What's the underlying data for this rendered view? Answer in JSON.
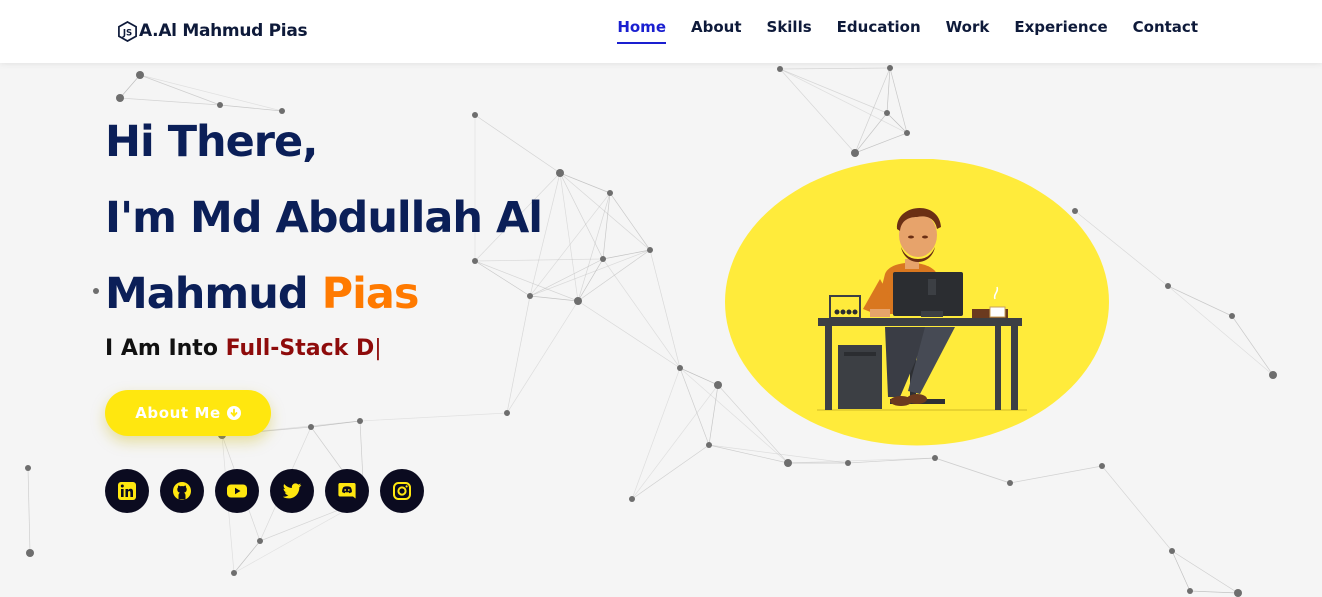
{
  "brand": {
    "text": "A.Al Mahmud Pias",
    "mark_icon": "logo-monogram-icon"
  },
  "nav": {
    "items": [
      {
        "label": "Home",
        "active": true
      },
      {
        "label": "About"
      },
      {
        "label": "Skills"
      },
      {
        "label": "Education"
      },
      {
        "label": "Work"
      },
      {
        "label": "Experience"
      },
      {
        "label": "Contact"
      }
    ]
  },
  "hero": {
    "line1": "Hi There,",
    "line2": "I'm Md Abdullah Al",
    "line3_prefix": "Mahmud ",
    "line3_accent": "Pias",
    "typed_prefix": "I Am Into ",
    "typed_text": "Full-Stack D",
    "typed_cursor": "|",
    "button_label": "About Me",
    "button_icon": "arrow-down-circle-icon"
  },
  "socials": [
    {
      "name": "linkedin-icon"
    },
    {
      "name": "github-icon"
    },
    {
      "name": "youtube-icon"
    },
    {
      "name": "twitter-icon"
    },
    {
      "name": "discord-icon"
    },
    {
      "name": "instagram-icon"
    }
  ],
  "colors": {
    "navy": "#0b1f58",
    "orange": "#ff7a00",
    "dark_red": "#8e0b0b",
    "yellow": "#ffe70f",
    "active_nav": "#1a1fd0",
    "social_bg": "#0b0b20",
    "social_icon": "#ffe70f"
  }
}
